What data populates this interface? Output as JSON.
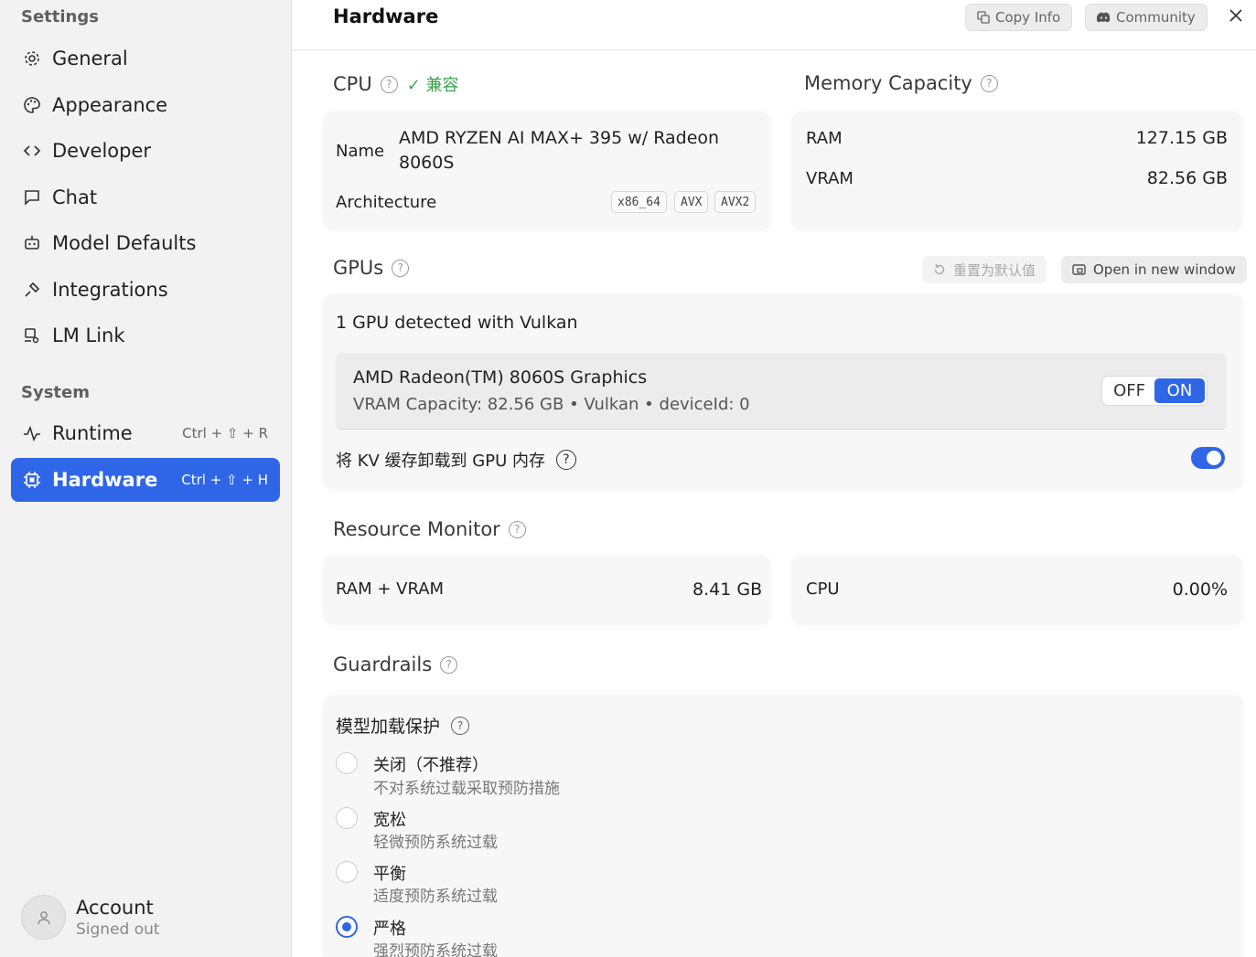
{
  "sidebar": {
    "settings_heading": "Settings",
    "settings_items": [
      {
        "label": "General",
        "icon": "gear-icon"
      },
      {
        "label": "Appearance",
        "icon": "palette-icon"
      },
      {
        "label": "Developer",
        "icon": "code-icon"
      },
      {
        "label": "Chat",
        "icon": "chat-bubble-icon"
      },
      {
        "label": "Model Defaults",
        "icon": "robot-icon"
      },
      {
        "label": "Integrations",
        "icon": "plug-icon"
      },
      {
        "label": "LM Link",
        "icon": "link-device-icon"
      }
    ],
    "system_heading": "System",
    "system_items": [
      {
        "label": "Runtime",
        "shortcut": "Ctrl + ⇧ + R",
        "icon": "activity-icon"
      },
      {
        "label": "Hardware",
        "shortcut": "Ctrl + ⇧ + H",
        "icon": "chip-icon",
        "active": true
      }
    ],
    "account": {
      "name": "Account",
      "status": "Signed out"
    }
  },
  "header": {
    "title": "Hardware",
    "copy_info_label": "Copy Info",
    "community_label": "Community"
  },
  "cpu": {
    "title": "CPU",
    "compat": "✓ 兼容",
    "name_label": "Name",
    "name_line1": "AMD RYZEN AI MAX+ 395 w/ Radeon",
    "name_line2": "8060S",
    "arch_label": "Architecture",
    "tags": [
      "x86_64",
      "AVX",
      "AVX2"
    ]
  },
  "memory": {
    "title": "Memory Capacity",
    "ram_label": "RAM",
    "ram_value": "127.15 GB",
    "vram_label": "VRAM",
    "vram_value": "82.56 GB"
  },
  "gpus": {
    "title": "GPUs",
    "reset_label": "重置为默认值",
    "open_window_label": "Open in new window",
    "detected": "1 GPU detected with Vulkan",
    "device_name": "AMD Radeon(TM) 8060S Graphics",
    "device_info": "VRAM Capacity: 82.56 GB • Vulkan • deviceId: 0",
    "toggle_off": "OFF",
    "toggle_on": "ON",
    "kv_offload_label": "将 KV 缓存卸载到 GPU 内存"
  },
  "resource_monitor": {
    "title": "Resource Monitor",
    "ram_vram_label": "RAM + VRAM",
    "ram_vram_value": "8.41 GB",
    "cpu_label": "CPU",
    "cpu_value": "0.00%"
  },
  "guardrails": {
    "title": "Guardrails",
    "subtitle": "模型加载保护",
    "options": [
      {
        "title": "关闭（不推荐）",
        "desc": "不对系统过载采取预防措施",
        "selected": false
      },
      {
        "title": "宽松",
        "desc": "轻微预防系统过载",
        "selected": false
      },
      {
        "title": "平衡",
        "desc": "适度预防系统过载",
        "selected": false
      },
      {
        "title": "严格",
        "desc": "强烈预防系统过载",
        "selected": true
      }
    ]
  },
  "colors": {
    "accent": "#2f66e8",
    "compat": "#3aa24a"
  }
}
